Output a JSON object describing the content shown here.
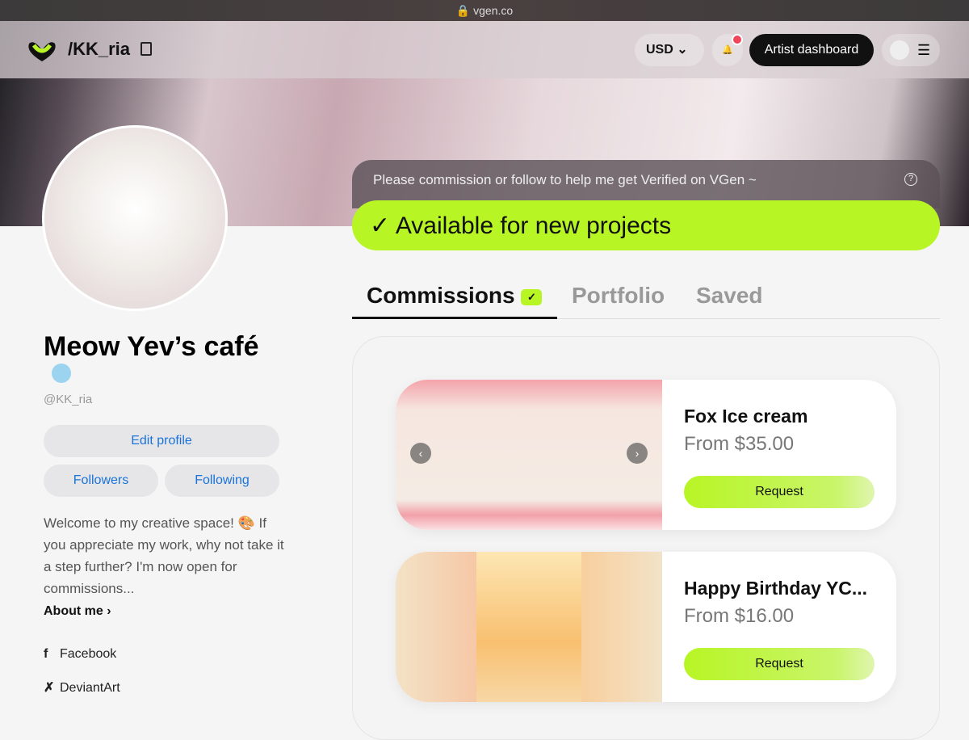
{
  "browser": {
    "url": "vgen.co"
  },
  "nav": {
    "handle": "/KK_ria",
    "currency": "USD",
    "dashboard_label": "Artist dashboard"
  },
  "profile": {
    "name": "Meow Yev’s café",
    "username": "@KK_ria",
    "edit_label": "Edit profile",
    "followers_label": "Followers",
    "following_label": "Following",
    "bio": "Welcome to my creative space! 🎨 If you appreciate my work, why not take it a step further? I'm now open for commissions...",
    "about_label": "About me ›",
    "socials": [
      {
        "icon": "facebook-icon",
        "glyph": "f",
        "label": "Facebook"
      },
      {
        "icon": "deviantart-icon",
        "glyph": "✗",
        "label": "DeviantArt"
      }
    ]
  },
  "banner": {
    "verify_text": "Please commission or follow to help me get Verified on VGen ~",
    "available_text": "✓  Available for new projects"
  },
  "tabs": [
    {
      "label": "Commissions",
      "active": true
    },
    {
      "label": "Portfolio"
    },
    {
      "label": "Saved"
    }
  ],
  "commissions": [
    {
      "title": "Fox Ice cream",
      "price": "From $35.00",
      "button": "Request"
    },
    {
      "title": "Happy Birthday YC...",
      "price": "From $16.00",
      "button": "Request"
    }
  ],
  "colors": {
    "accent": "#b8f525",
    "link": "#1a73d9"
  }
}
